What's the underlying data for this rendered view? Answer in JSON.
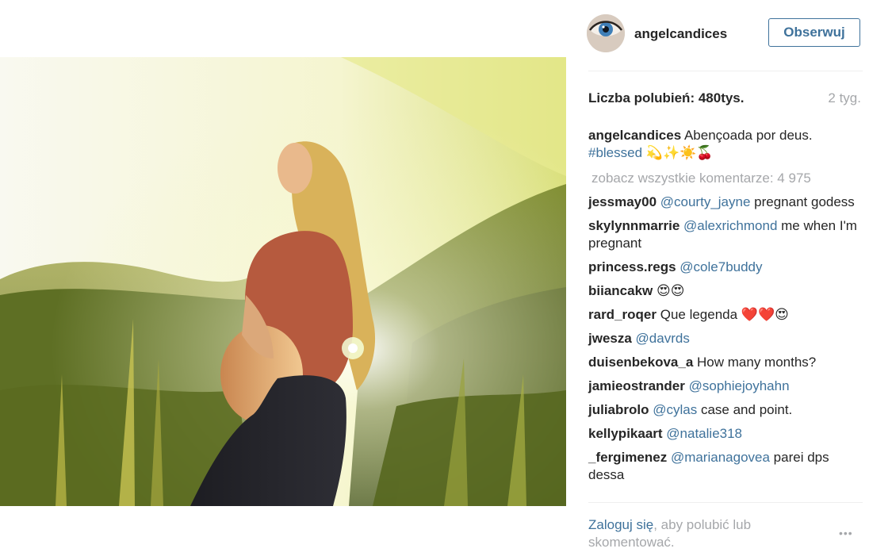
{
  "post": {
    "photo_alt": "pregnant woman standing in sunlit hills",
    "author": "angelcandices",
    "follow_label": "Obserwuj",
    "likes": "Liczba polubień: 480tys.",
    "time_ago": "2 tyg.",
    "caption": {
      "user": "angelcandices",
      "text": "Abençoada por deus.",
      "hashtag": "#blessed",
      "emoji": "💫✨☀️🍒"
    },
    "view_all": "zobacz wszystkie komentarze: 4 975"
  },
  "comments": [
    {
      "user": "jessmay00",
      "mention": "@courty_jayne",
      "text": "pregnant godess"
    },
    {
      "user": "skylynnmarrie",
      "mention": "@alexrichmond",
      "text": "me when I'm pregnant"
    },
    {
      "user": "princess.regs",
      "mention": "@cole7buddy",
      "text": ""
    },
    {
      "user": "biiancakw",
      "mention": "",
      "text": "😍😍"
    },
    {
      "user": "rard_roqer",
      "mention": "",
      "text": "Que legenda ❤️❤️😍"
    },
    {
      "user": "jwesza",
      "mention": "@davrds",
      "text": ""
    },
    {
      "user": "duisenbekova_a",
      "mention": "",
      "text": "How many months?"
    },
    {
      "user": "jamieostrander",
      "mention": "@sophiejoyhahn",
      "text": ""
    },
    {
      "user": "juliabrolo",
      "mention": "@cylas",
      "text": "case and point."
    },
    {
      "user": "kellypikaart",
      "mention": "@natalie318",
      "text": ""
    },
    {
      "user": "_fergimenez",
      "mention": "@marianagovea",
      "text": "parei dps dessa"
    }
  ],
  "footer": {
    "login_link": "Zaloguj się",
    "login_text": ", aby polubić lub skomentować.",
    "more_label": "•••"
  },
  "colors": {
    "link": "#3f729b",
    "muted": "#a5a7aa",
    "text": "#262626"
  }
}
